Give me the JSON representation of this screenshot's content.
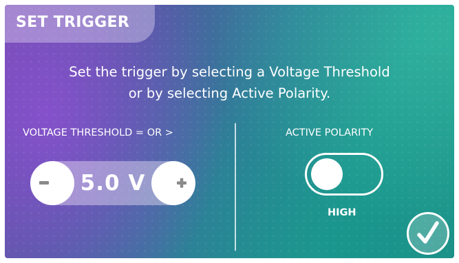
{
  "header": {
    "title": "SET TRIGGER"
  },
  "instruction": {
    "line1": "Set the trigger by selecting a Voltage Threshold",
    "line2": "or by selecting Active Polarity."
  },
  "voltage_threshold": {
    "label": "VOLTAGE THRESHOLD = OR >",
    "value": "5.0 V",
    "decrement_icon": "minus-icon",
    "increment_icon": "plus-icon"
  },
  "active_polarity": {
    "label": "ACTIVE POLARITY",
    "state": "HIGH"
  },
  "confirm": {
    "icon": "checkmark-icon"
  },
  "colors": {
    "bg_purple": "#6f4aa8",
    "bg_teal": "#1f8f86",
    "text": "#ffffff",
    "icon_gray": "#8a8a8a"
  }
}
